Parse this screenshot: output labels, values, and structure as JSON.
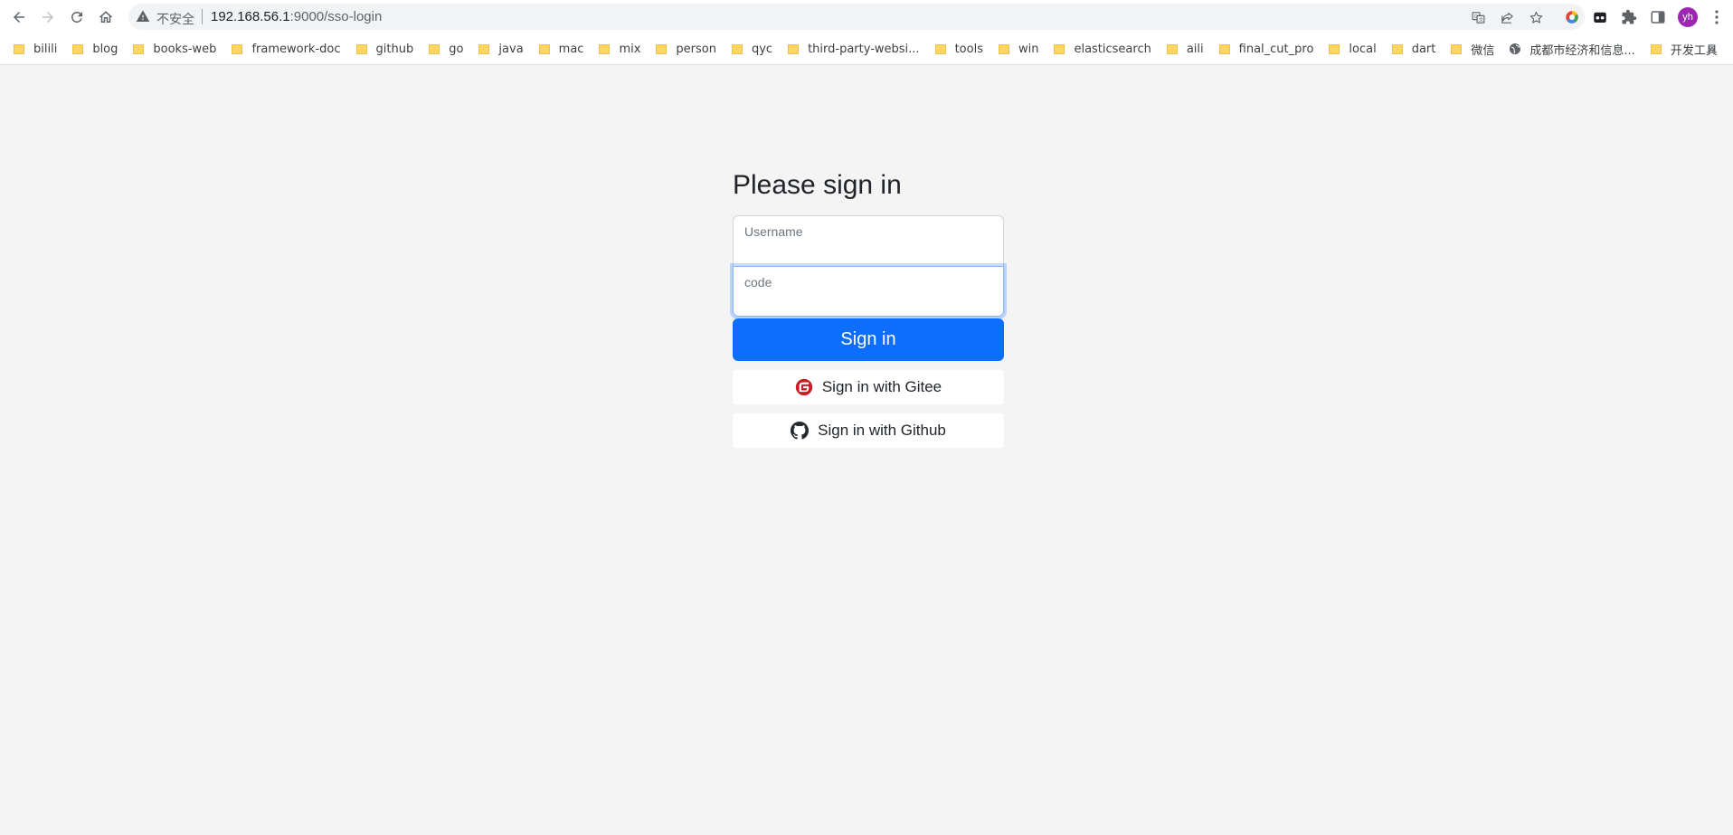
{
  "browser": {
    "insecure_label": "不安全",
    "url_host": "192.168.56.1",
    "url_rest": ":9000/sso-login",
    "profile_initials": "yh"
  },
  "bookmarks": [
    {
      "label": "bilili",
      "icon": "folder-icon"
    },
    {
      "label": "blog",
      "icon": "folder-icon"
    },
    {
      "label": "books-web",
      "icon": "folder-icon"
    },
    {
      "label": "framework-doc",
      "icon": "folder-icon"
    },
    {
      "label": "github",
      "icon": "folder-icon"
    },
    {
      "label": "go",
      "icon": "folder-icon"
    },
    {
      "label": "java",
      "icon": "folder-icon"
    },
    {
      "label": "mac",
      "icon": "folder-icon"
    },
    {
      "label": "mix",
      "icon": "folder-icon"
    },
    {
      "label": "person",
      "icon": "folder-icon"
    },
    {
      "label": "qyc",
      "icon": "folder-icon"
    },
    {
      "label": "third-party-websi...",
      "icon": "folder-icon"
    },
    {
      "label": "tools",
      "icon": "folder-icon"
    },
    {
      "label": "win",
      "icon": "folder-icon"
    },
    {
      "label": "elasticsearch",
      "icon": "folder-icon"
    },
    {
      "label": "aili",
      "icon": "folder-icon"
    },
    {
      "label": "final_cut_pro",
      "icon": "folder-icon"
    },
    {
      "label": "local",
      "icon": "folder-icon"
    },
    {
      "label": "dart",
      "icon": "folder-icon"
    },
    {
      "label": "微信",
      "icon": "folder-icon"
    },
    {
      "label": "成都市经济和信息...",
      "icon": "globe-icon"
    },
    {
      "label": "开发工具",
      "icon": "folder-icon"
    }
  ],
  "form": {
    "heading": "Please sign in",
    "username": {
      "placeholder": "Username",
      "value": ""
    },
    "code": {
      "placeholder": "code",
      "value": ""
    },
    "submit_label": "Sign in",
    "gitee_label": "Sign in with Gitee",
    "github_label": "Sign in with Github"
  },
  "colors": {
    "page_bg": "#f4f4f4",
    "primary": "#0d6efd",
    "gitee_red": "#c71d23",
    "github_black": "#24292f",
    "focus_ring": "#86b7fe"
  }
}
